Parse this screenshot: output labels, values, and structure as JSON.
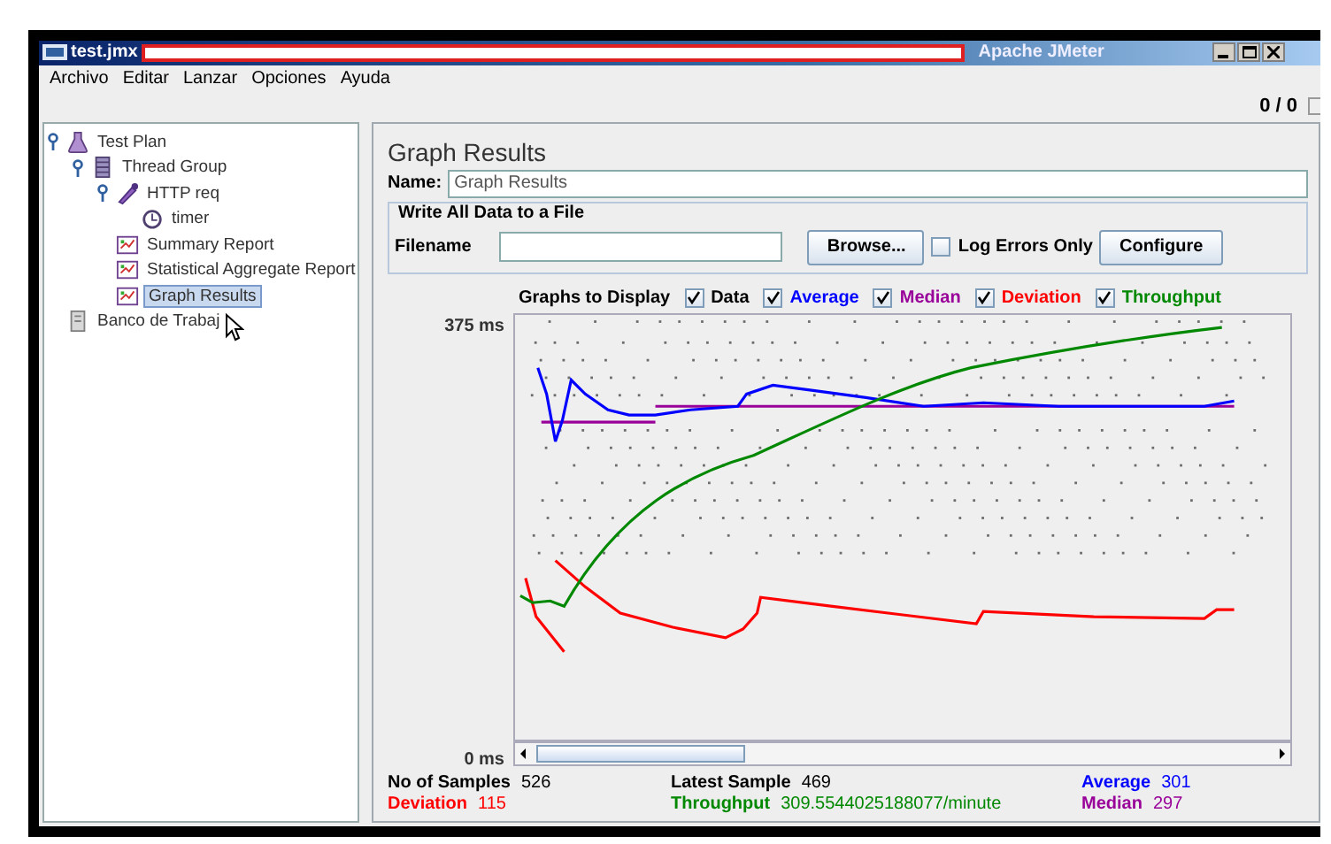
{
  "window": {
    "title": "test.jmx",
    "app_name": "Apache JMeter"
  },
  "menu": [
    "Archivo",
    "Editar",
    "Lanzar",
    "Opciones",
    "Ayuda"
  ],
  "counter": "0 / 0",
  "tree": [
    {
      "label": "Test Plan",
      "kind": "plan",
      "expanded": true,
      "selected": false,
      "children": [
        {
          "label": "Thread Group",
          "kind": "threads",
          "expanded": true,
          "selected": false,
          "children": [
            {
              "label": "HTTP req",
              "kind": "sampler",
              "expanded": true,
              "selected": false,
              "children": [
                {
                  "label": "timer",
                  "kind": "timer",
                  "selected": false
                }
              ]
            },
            {
              "label": "Summary Report",
              "kind": "report",
              "selected": false
            },
            {
              "label": "Statistical Aggregate Report",
              "kind": "report",
              "selected": false
            },
            {
              "label": "Graph Results",
              "kind": "report",
              "selected": true
            }
          ]
        }
      ]
    },
    {
      "label": "Banco de Trabaj",
      "kind": "workbench",
      "selected": false
    }
  ],
  "panel": {
    "title": "Graph Results",
    "name_label": "Name:",
    "name_value": "Graph Results",
    "file_group": {
      "legend": "Write All Data to a File",
      "filename_label": "Filename",
      "browse_button": "Browse...",
      "log_errors": {
        "label": "Log Errors Only",
        "checked": false
      },
      "configure_button": "Configure"
    },
    "graphs_label": "Graphs to Display",
    "graphs": [
      {
        "label": "Data",
        "checked": true,
        "color": "#000000"
      },
      {
        "label": "Average",
        "checked": true,
        "color": "#0000ff"
      },
      {
        "label": "Median",
        "checked": true,
        "color": "#990099"
      },
      {
        "label": "Deviation",
        "checked": true,
        "color": "#ff0000"
      },
      {
        "label": "Throughput",
        "checked": true,
        "color": "#008800"
      }
    ],
    "y_max_label": "375 ms",
    "y_min_label": "0 ms",
    "stats": [
      {
        "label": "No of Samples",
        "value": "526",
        "color": "#000000"
      },
      {
        "label": "Latest Sample",
        "value": "469",
        "color": "#000000"
      },
      {
        "label": "Average",
        "value": "301",
        "color": "#0000ff"
      },
      {
        "label": "Deviation",
        "value": "115",
        "color": "#ff0000"
      },
      {
        "label": "Throughput",
        "value": "309.5544025188077/minute",
        "color": "#008800"
      },
      {
        "label": "Median",
        "value": "297",
        "color": "#990099"
      }
    ]
  }
}
